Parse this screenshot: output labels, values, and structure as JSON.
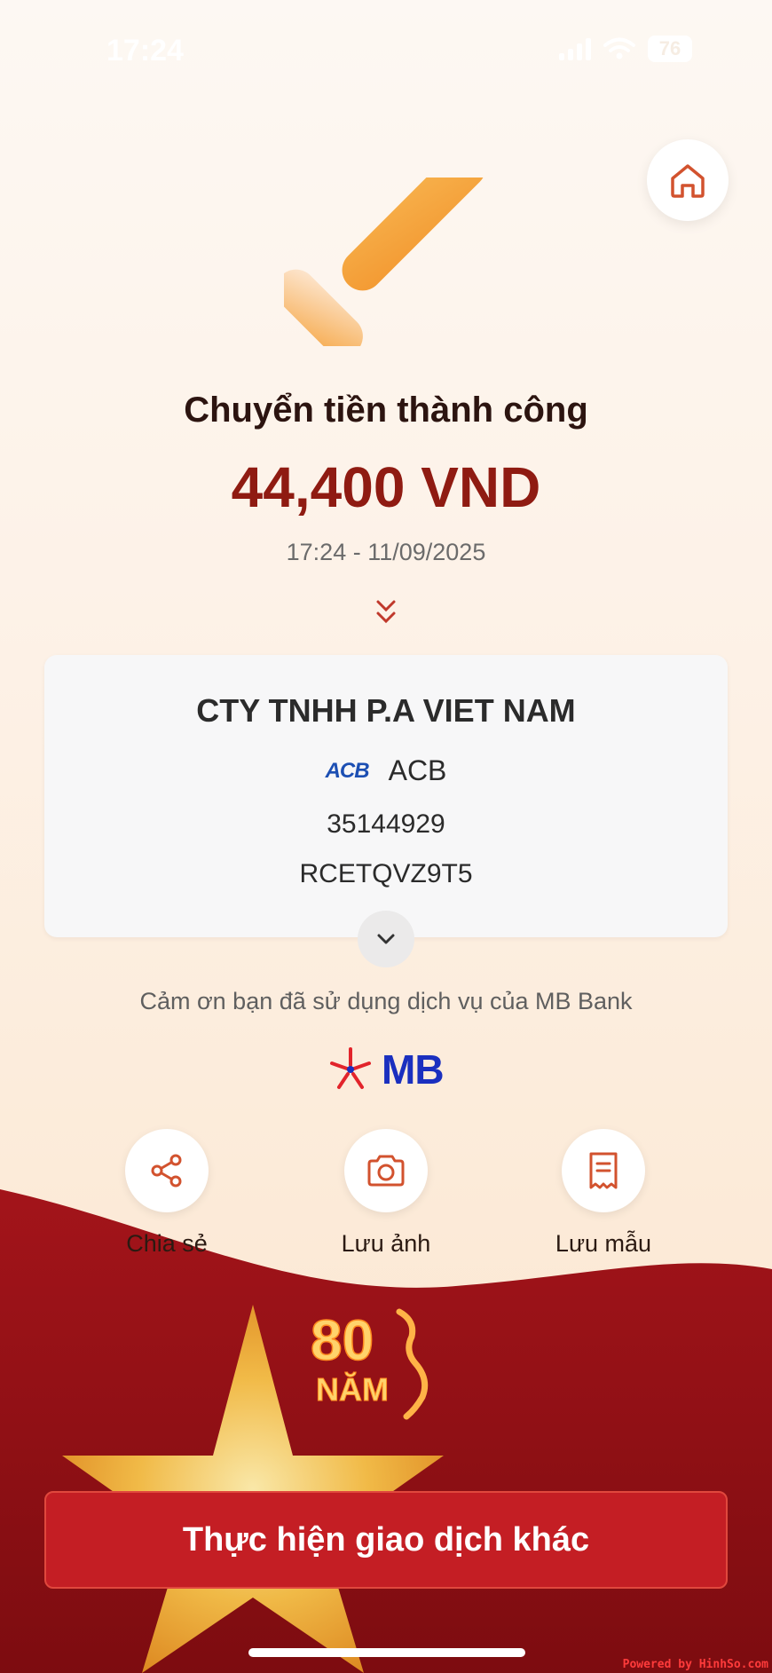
{
  "status_bar": {
    "time": "17:24",
    "battery": "76"
  },
  "result": {
    "title": "Chuyển tiền thành công",
    "amount": "44,400 VND",
    "datetime": "17:24 - 11/09/2025"
  },
  "recipient": {
    "name": "CTY TNHH P.A VIET NAM",
    "bank_logo_text": "ACB",
    "bank_name": "ACB",
    "account_number": "35144929",
    "reference": "RCETQVZ9T5"
  },
  "thanks_text": "Cảm ơn bạn đã sử dụng dịch vụ của MB Bank",
  "brand": {
    "logo_text": "MB",
    "accent": "#c41e24",
    "blue": "#1a2fbf"
  },
  "actions": [
    {
      "label": "Chia sẻ",
      "icon": "share-icon"
    },
    {
      "label": "Lưu ảnh",
      "icon": "camera-icon"
    },
    {
      "label": "Lưu mẫu",
      "icon": "receipt-icon"
    }
  ],
  "anniversary": {
    "number": "80",
    "word": "NĂM"
  },
  "cta_label": "Thực hiện giao dịch khác",
  "watermark": "Powered by HinhSo.com"
}
